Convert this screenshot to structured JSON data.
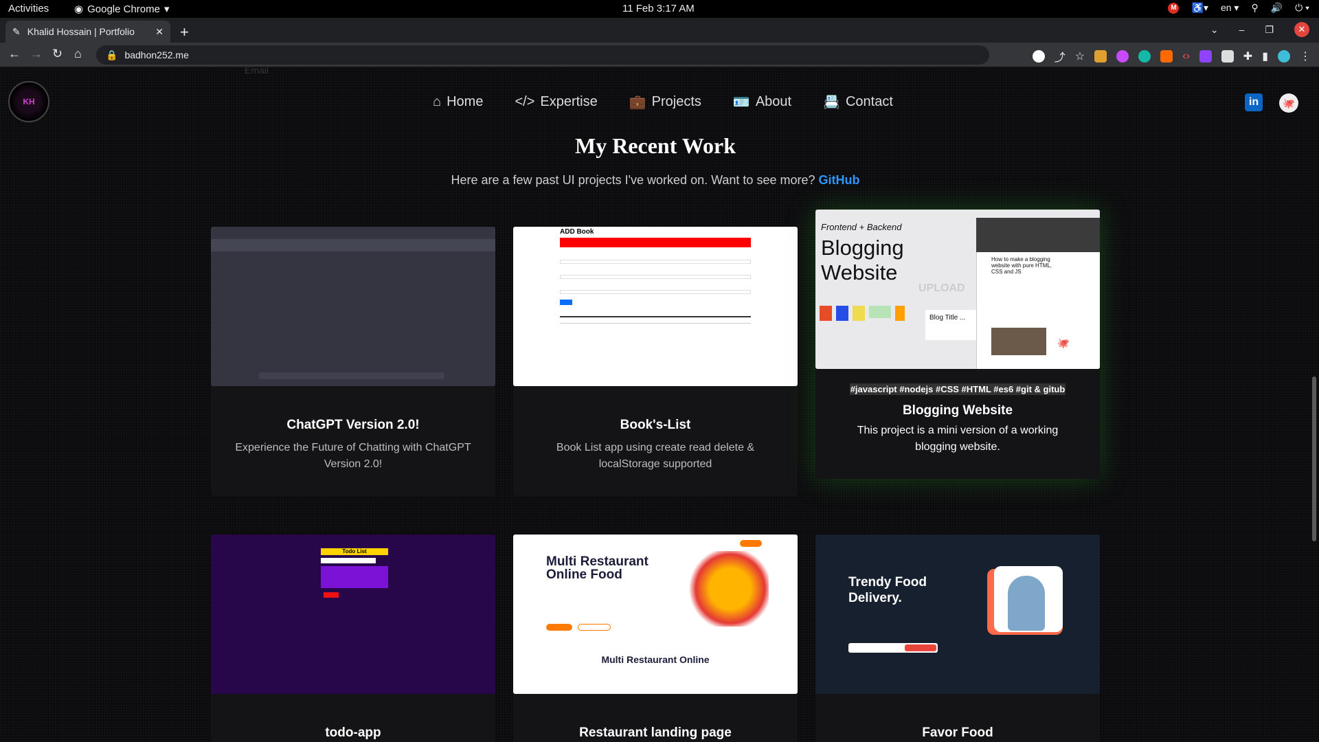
{
  "system": {
    "activities": "Activities",
    "app_name": "Google Chrome",
    "clock": "11 Feb  3:17 AM",
    "lang": "en"
  },
  "browser": {
    "tab_title": "Khalid Hossain | Portfolio",
    "url": "badhon252.me"
  },
  "site": {
    "logo_text": "KH",
    "ghost_text": "Email",
    "nav": [
      "Home",
      "Expertise",
      "Projects",
      "About",
      "Contact"
    ]
  },
  "section": {
    "title": "My Recent Work",
    "subtitle": "Here are a few past UI projects I've worked on. Want to see more?",
    "subtitle_link": "GitHub"
  },
  "projects": [
    {
      "title": "ChatGPT Version 2.0!",
      "desc": "Experience the Future of Chatting with ChatGPT Version 2.0!"
    },
    {
      "title": "Book's-List",
      "desc": "Book List app using create read delete & localStorage supported",
      "thumb_title": "ADD Book"
    },
    {
      "title": "Blogging Website",
      "desc": "This project is a mini version of a working blogging website.",
      "tags": "#javascript #nodejs #CSS #HTML #es6 #git & gitub",
      "thumb_label": "Frontend + Backend",
      "thumb_title": "Blogging Website",
      "thumb_upload": "UPLOAD",
      "thumb_blog_title": "Blog Title ...",
      "thumb_article": "How to make a blogging website with pure HTML, CSS and JS"
    },
    {
      "title": "todo-app",
      "thumb_title": "Todo List"
    },
    {
      "title": "Restaurant landing page",
      "thumb_title": "Multi Restaurant Online Food",
      "thumb_caption": "Multi Restaurant Online"
    },
    {
      "title": "Favor Food",
      "thumb_title": "Trendy Food Delivery."
    }
  ]
}
